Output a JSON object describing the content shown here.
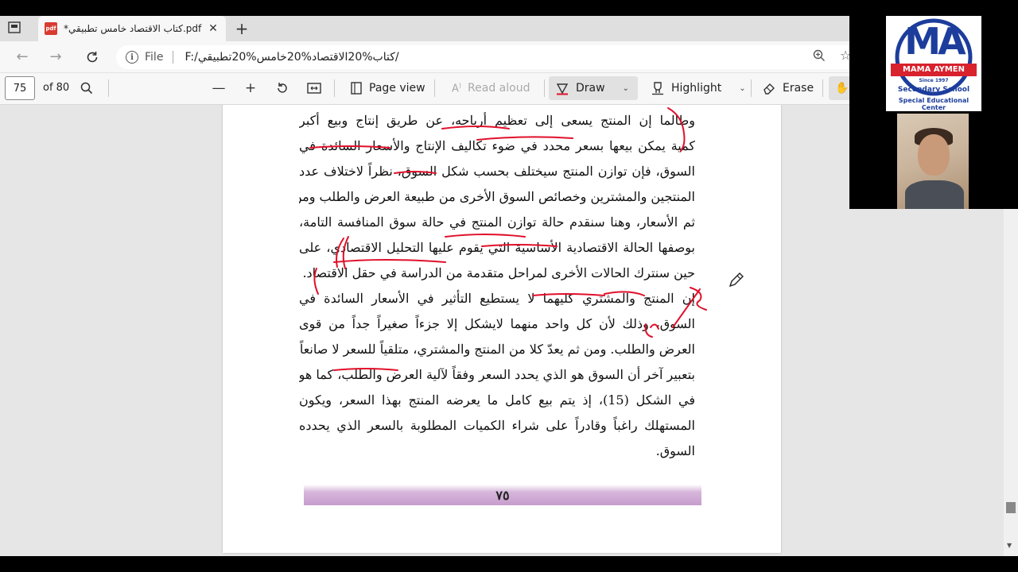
{
  "browser": {
    "tab_title": "*كتاب الاقتصاد خامس تطبيقي.pdf",
    "pdf_badge": "pdf",
    "url_scheme": "File",
    "url": "F:/كتاب%20الاقتصاد%20خامس%20تطبيقي/"
  },
  "pdf_toolbar": {
    "page_number": "75",
    "page_total": "of 80",
    "page_view_label": "Page view",
    "read_aloud_label": "Read aloud",
    "draw_label": "Draw",
    "highlight_label": "Highlight",
    "erase_label": "Erase"
  },
  "page": {
    "lines": [
      "وطالما إن المنتج يسعى إلى تعظيم أرباحه، عن طريق إنتاج وبيع أكبر",
      "كمية يمكن بيعها بسعر محدد في ضوء تكاليف الإنتاج والأسعار السائدة في",
      "السوق، فإن توازن المنتج سيختلف بحسب شكل السوق، نظراً لاختلاف عدد",
      "المنتجين والمشترين وخصائص السوق الأخرى من طبيعة العرض والطلب ومن",
      "ثم الأسعار، وهنا سنقدم حالة توازن المنتج في حالة سوق المنافسة التامة،",
      "بوصفها الحالة الاقتصادية الأساسية التي يقوم عليها التحليل الاقتصادي، على",
      "حين سنترك الحالات الأخرى لمراحل متقدمة من الدراسة في حقل الاقتصاد.",
      "إن المنتج والمشتري كليهما لا يستطيع التأثير في الأسعار السائدة في",
      "السوق، وذلك لأن كل واحد منهما لايشكل إلا جزءاً صغيراً جداً من قوى",
      "العرض والطلب. ومن ثم يعدّ كلا من المنتج والمشتري، متلقياً للسعر لا صانعاً له، أي",
      "بتعبير آخر أن السوق هو الذي يحدد السعر وفقاً لآلية العرض والطلب، كما هو",
      "في الشكل (15)، إذ يتم بيع كامل ما يعرضه المنتج بهذا السعر، ويكون",
      "المستهلك راغباً وقادراً على شراء الكميات المطلوبة بالسعر الذي يحدده",
      "السوق."
    ],
    "page_footer_number": "٧٥"
  },
  "overlay": {
    "logo_letters": "MA",
    "logo_name": "MAMA AYMEN",
    "logo_since": "Since 1997",
    "logo_school": "Secondary School",
    "logo_center": "Special Educational Center"
  },
  "colors": {
    "ink_red": "#e0102a",
    "band_pink": "#c79ccd",
    "logo_blue": "#1c3d9c",
    "logo_red": "#d8222d"
  }
}
